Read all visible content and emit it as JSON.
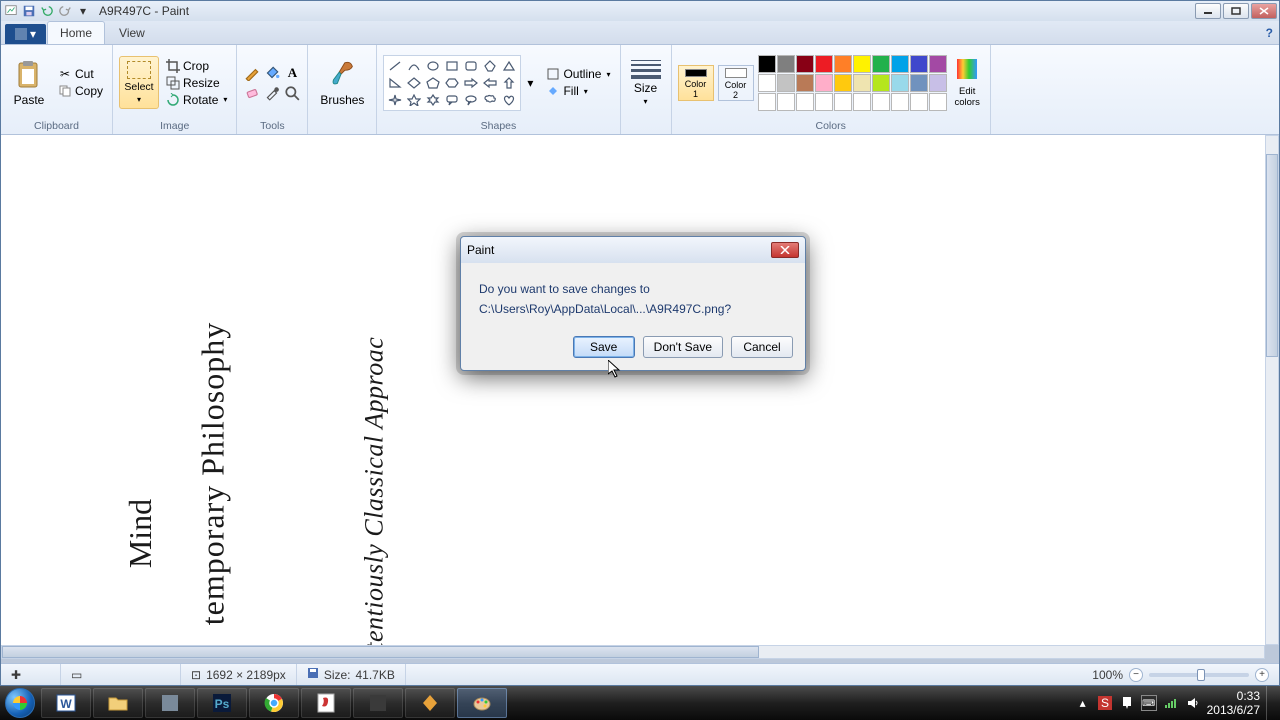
{
  "title": "A9R497C - Paint",
  "tabs": {
    "home": "Home",
    "view": "View"
  },
  "clipboard": {
    "paste": "Paste",
    "cut": "Cut",
    "copy": "Copy",
    "label": "Clipboard"
  },
  "image": {
    "select": "Select",
    "crop": "Crop",
    "resize": "Resize",
    "rotate": "Rotate",
    "label": "Image"
  },
  "tools": {
    "label": "Tools"
  },
  "brushes": {
    "label": "Brushes"
  },
  "shapes": {
    "outline": "Outline",
    "fill": "Fill",
    "label": "Shapes"
  },
  "size": {
    "label": "Size"
  },
  "colors": {
    "c1": "Color\n1",
    "c2": "Color\n2",
    "edit": "Edit\ncolors",
    "label": "Colors",
    "row1": [
      "#000000",
      "#7f7f7f",
      "#880015",
      "#ed1c24",
      "#ff7f27",
      "#fff200",
      "#22b14c",
      "#00a2e8",
      "#3f48cc",
      "#a349a4"
    ],
    "row2": [
      "#ffffff",
      "#c3c3c3",
      "#b97a57",
      "#ffaec9",
      "#ffc90e",
      "#efe4b0",
      "#b5e61d",
      "#99d9ea",
      "#7092be",
      "#c8bfe7"
    ],
    "row3": [
      "#ffffff",
      "#ffffff",
      "#ffffff",
      "#ffffff",
      "#ffffff",
      "#ffffff",
      "#ffffff",
      "#ffffff",
      "#ffffff",
      "#ffffff"
    ]
  },
  "canvas": {
    "text1": "temporary Philosophy",
    "text2": "Mind",
    "text3": "ntentiously Classical Approac"
  },
  "status": {
    "dims_icon": "⊡",
    "dims": "1692 × 2189px",
    "size_label": "Size:",
    "size": "41.7KB",
    "zoom": "100%"
  },
  "dialog": {
    "title": "Paint",
    "line1": "Do you want to save changes to",
    "line2": "C:\\Users\\Roy\\AppData\\Local\\...\\A9R497C.png?",
    "save": "Save",
    "dontsave": "Don't Save",
    "cancel": "Cancel"
  },
  "tray": {
    "time": "0:33",
    "date": "2013/6/27"
  }
}
